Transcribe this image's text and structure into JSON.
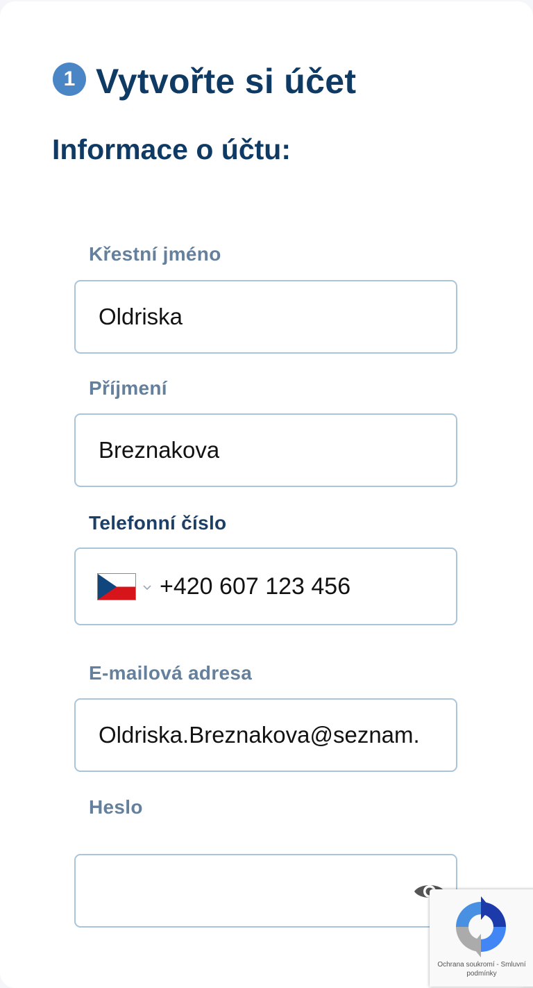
{
  "step": {
    "number": "1",
    "title": "Vytvořte si účet"
  },
  "section": {
    "title": "Informace o účtu:"
  },
  "fields": {
    "first_name": {
      "label": "Křestní jméno",
      "value": "Oldriska"
    },
    "last_name": {
      "label": "Příjmení",
      "value": "Breznakova"
    },
    "phone": {
      "label": "Telefonní číslo",
      "value": "+420 607 123 456",
      "country_flag": "czech-flag-icon"
    },
    "email": {
      "label": "E-mailová adresa",
      "value": "Oldriska.Breznakova@seznam."
    },
    "password": {
      "label": "Heslo",
      "value": ""
    }
  },
  "recaptcha": {
    "privacy": "Ochrana soukromí",
    "separator": "-",
    "terms": "Smluvní podmínky"
  },
  "colors": {
    "heading": "#0f3a63",
    "label": "#64809c",
    "label_active": "#1b3f66",
    "badge": "#4a86c5",
    "field_border": "#aac4d8"
  }
}
